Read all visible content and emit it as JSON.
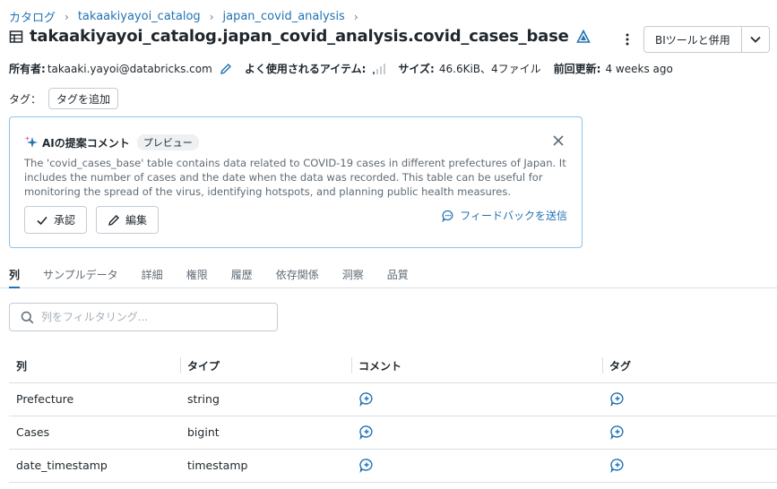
{
  "breadcrumb": {
    "items": [
      "カタログ",
      "takaakiyayoi_catalog",
      "japan_covid_analysis"
    ],
    "separator": "›"
  },
  "title": "takaakiyayoi_catalog.japan_covid_analysis.covid_cases_base",
  "header_actions": {
    "bi_button": "BIツールと併用"
  },
  "meta": {
    "owner_label": "所有者:",
    "owner_value": "takaaki.yayoi@databricks.com",
    "frequent_label": "よく使用されるアイテム:",
    "size_label": "サイズ:",
    "size_value": "46.6KiB、4ファイル",
    "updated_label": "前回更新:",
    "updated_value": "4 weeks ago"
  },
  "tags": {
    "label": "タグ：",
    "add_button": "タグを追加"
  },
  "ai_comment": {
    "title": "AIの提案コメント",
    "badge": "プレビュー",
    "description": "The 'covid_cases_base' table contains data related to COVID-19 cases in different prefectures of Japan. It includes the number of cases and the date when the data was recorded. This table can be useful for monitoring the spread of the virus, identifying hotspots, and planning public health measures.",
    "approve_button": "承認",
    "edit_button": "編集",
    "feedback_link": "フィードバックを送信"
  },
  "tabs": [
    {
      "label": "列",
      "active": true
    },
    {
      "label": "サンプルデータ",
      "active": false
    },
    {
      "label": "詳細",
      "active": false
    },
    {
      "label": "権限",
      "active": false
    },
    {
      "label": "履歴",
      "active": false
    },
    {
      "label": "依存関係",
      "active": false
    },
    {
      "label": "洞察",
      "active": false
    },
    {
      "label": "品質",
      "active": false
    }
  ],
  "filter": {
    "placeholder": "列をフィルタリング..."
  },
  "columns_table": {
    "headers": [
      "列",
      "タイプ",
      "コメント",
      "タグ"
    ],
    "rows": [
      {
        "name": "Prefecture",
        "type": "string"
      },
      {
        "name": "Cases",
        "type": "bigint"
      },
      {
        "name": "date_timestamp",
        "type": "timestamp"
      }
    ]
  },
  "colors": {
    "accent": "#2272b4",
    "border": "#c4ccd4",
    "ai_border": "#8fc3ed"
  }
}
